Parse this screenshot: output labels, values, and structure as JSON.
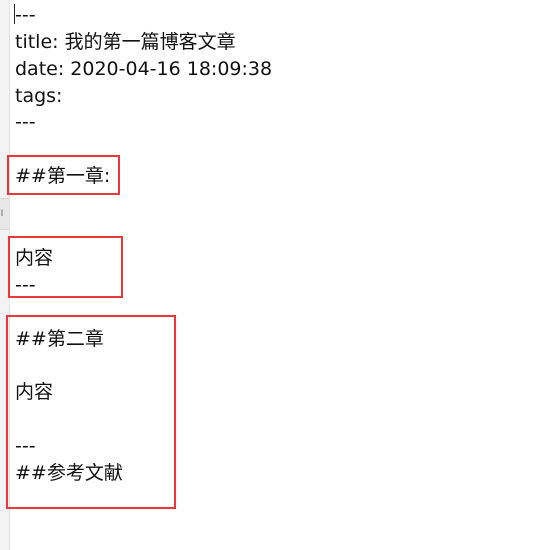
{
  "editor": {
    "lines": {
      "front_start": "---",
      "title": "title: 我的第一篇博客文章",
      "date": "date: 2020-04-16 18:09:38",
      "tags": "tags:",
      "front_end": "---",
      "chapter1": "##第一章:",
      "content1": "内容",
      "sep1": "---",
      "chapter2": "##第二章",
      "content2": "内容",
      "sep2": "---",
      "references": "##参考文献"
    }
  },
  "colors": {
    "highlight_box": "#e8373d",
    "text": "#111111",
    "background": "#ffffff"
  },
  "left_edge": {
    "glyph": "l"
  }
}
